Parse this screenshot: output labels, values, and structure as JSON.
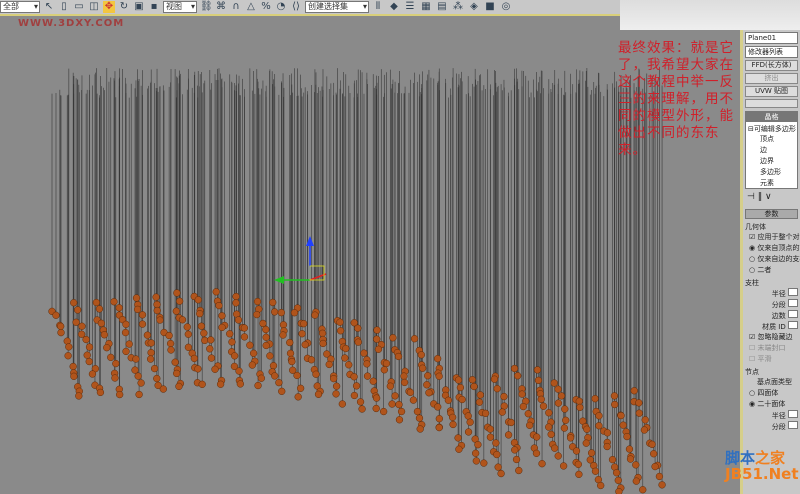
{
  "toolbar": {
    "selection_filter": "全部",
    "reference_coord": "视图",
    "named_selection": "创建选择集",
    "icons": [
      "select-icon",
      "select-by-name-icon",
      "rect-region-icon",
      "window-crossing-icon",
      "move-icon",
      "rotate-icon",
      "scale-icon",
      "pivot-icon",
      "link-icon",
      "bind-icon",
      "snap-icon",
      "angle-snap-icon",
      "percent-snap-icon",
      "spinner-snap-icon",
      "edit-named-sel-icon",
      "mirror-icon",
      "align-icon",
      "layer-icon",
      "curve-editor-icon",
      "schematic-icon",
      "material-editor-icon",
      "render-setup-icon",
      "render-frame-icon",
      "quick-render-icon"
    ]
  },
  "watermark_top": "WWW.3DXY.COM",
  "annotation": "最终效果：就是它了，我希望大家在这个教程中举一反三的来理解，用不同的模型外形，能做出不同的东东来。",
  "panel": {
    "object_name": "Plane01",
    "modifier_list": "修改器列表",
    "buttons": [
      "FFD(长方体)",
      "挤出",
      "UVW 贴图"
    ],
    "stack_top": "晶格",
    "stack_base": "可编辑多边形",
    "sub_objects": [
      "顶点",
      "边",
      "边界",
      "多边形",
      "元素"
    ],
    "params_title": "参数",
    "geometry_group": "几何体",
    "apply_whole": "应用于整个对象",
    "geom_options": [
      "仅来自顶点的节点",
      "仅来自边的支柱",
      "二者"
    ],
    "struts_group": "支柱",
    "strut_fields": [
      "半径",
      "分段",
      "边数",
      "材质 ID"
    ],
    "strut_checks": [
      "忽略隐藏边",
      "末端封口",
      "平滑"
    ],
    "joints_group": "节点",
    "base_type": "基点面类型",
    "base_options": [
      "四面体",
      "二十面体"
    ],
    "joint_fields": [
      "半径",
      "分段"
    ]
  },
  "watermark": {
    "line1a": "脚本",
    "line1b": "之家",
    "line2": "JB51.Net"
  },
  "colors": {
    "sphere": "#b0541c",
    "annotation": "#d0202a",
    "viewport": "#8a8a8a"
  }
}
